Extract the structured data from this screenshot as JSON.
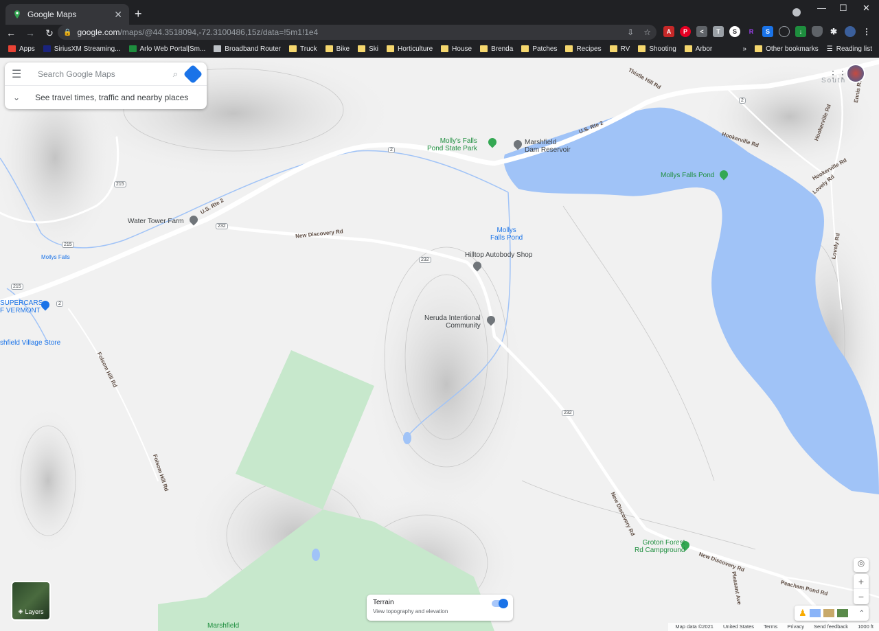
{
  "browser": {
    "tab_title": "Google Maps",
    "tab_close": "✕",
    "new_tab": "+",
    "win_min": "—",
    "win_max": "☐",
    "win_close": "✕",
    "url_host": "google.com",
    "url_path": "/maps/@44.3518094,-72.3100486,15z/data=!5m1!1e4",
    "bookmarks": [
      "Apps",
      "SiriusXM Streaming...",
      "Arlo Web Portal|Sm...",
      "Broadband Router",
      "Truck",
      "Bike",
      "Ski",
      "Horticulture",
      "House",
      "Brenda",
      "Patches",
      "Recipes",
      "RV",
      "Shooting",
      "Arbor"
    ],
    "more_bookmarks": "»",
    "other_bookmarks": "Other bookmarks",
    "reading_list": "Reading list"
  },
  "search": {
    "placeholder": "Search Google Maps",
    "travel_text": "See travel times, traffic and nearby places"
  },
  "map_labels": {
    "mollys_falls_state_park": "Molly's Falls",
    "mollys_falls_state_park_2": "Pond State Park",
    "marshfield_dam": "Marshfield",
    "marshfield_dam_2": "Dam Reservoir",
    "mollys_falls_pond": "Mollys Falls Pond",
    "mollys_falls_pond_water": "Mollys",
    "mollys_falls_pond_water_2": "Falls Pond",
    "water_tower_farm": "Water Tower Farm",
    "hilltop_autobody": "Hilltop Autobody Shop",
    "neruda": "Neruda Intentional",
    "neruda_2": "Community",
    "supercars": "SUPERCARS",
    "supercars_2": "F VERMONT",
    "village_store": "shfield Village Store",
    "groton_forest": "Groton Forest",
    "groton_forest_2": "Rd Campground",
    "marshfield_bottom": "Marshfield",
    "mollys_falls_small": "Mollys Falls",
    "south_label": "South"
  },
  "road_labels": {
    "us_rte_2_a": "U.S. Rte 2",
    "us_rte_2_b": "U.S. Rte 2",
    "new_discovery_1": "New Discovery Rd",
    "new_discovery_2": "New Discovery Rd",
    "new_discovery_3": "New Discovery Rd",
    "hookerville_1": "Hookerville Rd",
    "hookerville_2": "Hookerville Rd",
    "hookerville_3": "Hookerville Rd",
    "thistle_hill": "Thistle Hill Rd",
    "folsom_hill_1": "Folsom Hill Rd",
    "folsom_hill_2": "Folsom Hill Rd",
    "lovely_rd": "Lovely Rd",
    "peacham_pond": "Peacham Pond Rd",
    "pleasant_ave": "Pleasant Ave",
    "lovely_rd_top": "Lovely Rd",
    "ennis_rd": "Ennis Rd"
  },
  "shields": {
    "rte2": "2",
    "rte215": "215",
    "rte232": "232"
  },
  "controls": {
    "layers": "Layers",
    "terrain_title": "Terrain",
    "terrain_sub": "View topography and elevation",
    "terrain_on": true,
    "zoom_in": "+",
    "zoom_out": "−"
  },
  "footer": {
    "map_data": "Map data ©2021",
    "country": "United States",
    "terms": "Terms",
    "privacy": "Privacy",
    "feedback": "Send feedback",
    "scale": "1000 ft"
  },
  "colors": {
    "water": "#a0c3f7",
    "park": "#c7e8cc",
    "accent": "#1a73e8"
  }
}
